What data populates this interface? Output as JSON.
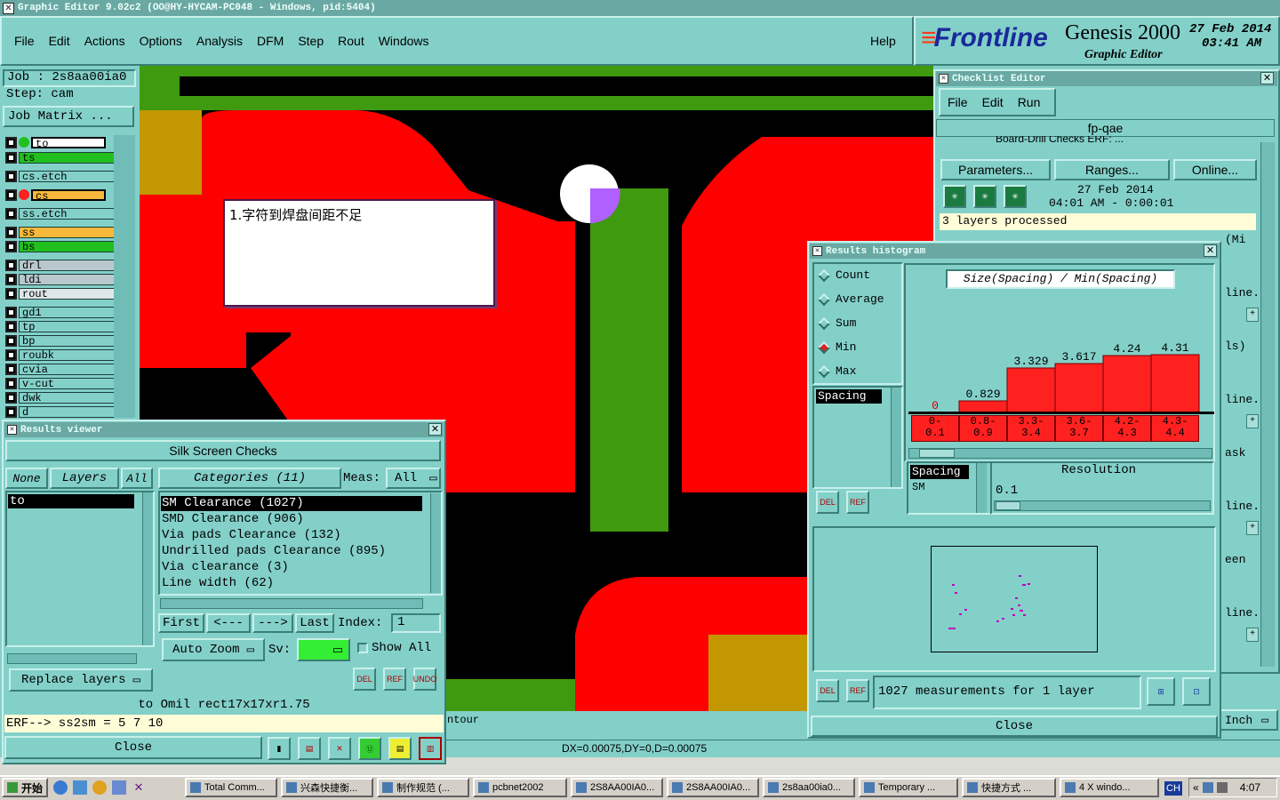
{
  "app": {
    "title": "Graphic Editor 9.02c2 (OO@HY-HYCAM-PC048 - Windows, pid:5404)",
    "menu": [
      "File",
      "Edit",
      "Actions",
      "Options",
      "Analysis",
      "DFM",
      "Step",
      "Rout",
      "Windows"
    ],
    "help": "Help",
    "brand": "Frontline",
    "product": "Genesis 2000",
    "subtitle": "Graphic Editor",
    "date": "27 Feb 2014",
    "time": "03:41 AM"
  },
  "job": {
    "job_label": "Job : 2s8aa00ia0",
    "step_label": "Step: cam",
    "matrix_button": "Job Matrix ..."
  },
  "layers": [
    {
      "name": "to",
      "color": "#ffffff",
      "sel": true
    },
    {
      "name": "ts",
      "color": "#22c01e"
    },
    {
      "name": "cs.etch",
      "color": "#83d0c9"
    },
    {
      "name": "cs",
      "color": "#f7b83b",
      "sel": true
    },
    {
      "name": "ss.etch",
      "color": "#83d0c9"
    },
    {
      "name": "ss",
      "color": "#f7b83b"
    },
    {
      "name": "bs",
      "color": "#22c01e"
    },
    {
      "name": "drl",
      "color": "#b9c8cc"
    },
    {
      "name": "ldi",
      "color": "#b9c8cc"
    },
    {
      "name": "rout",
      "color": "#dfe6e8"
    },
    {
      "name": "gd1",
      "color": "#83d0c9"
    },
    {
      "name": "tp",
      "color": "#83d0c9"
    },
    {
      "name": "bp",
      "color": "#83d0c9"
    },
    {
      "name": "roubk",
      "color": "#83d0c9"
    },
    {
      "name": "cvia",
      "color": "#83d0c9"
    },
    {
      "name": "v-cut",
      "color": "#83d0c9"
    },
    {
      "name": "dwk",
      "color": "#83d0c9"
    },
    {
      "name": "d",
      "color": "#83d0c9"
    }
  ],
  "annotation": "1.字符到焊盘间距不足",
  "checklist": {
    "title": "Checklist Editor",
    "menu": [
      "File",
      "Edit",
      "Run"
    ],
    "name": "fp-qae",
    "partial_row": "Board-Drill Checks   ERF:  ...",
    "buttons": [
      "Parameters...",
      "Ranges...",
      "Online..."
    ],
    "run_date": "27 Feb 2014",
    "run_time": "04:01 AM - 0:00:01",
    "status": "3 layers processed",
    "side_fragments": [
      "(Mi",
      "line...",
      "ls)",
      "line...",
      "ask",
      "line...",
      "een",
      "line..."
    ]
  },
  "results_viewer": {
    "title": "Results viewer",
    "heading": "Silk Screen Checks",
    "tabs": [
      "None",
      "Layers",
      "All"
    ],
    "layer_items": [
      "to"
    ],
    "categories_label": "Categories (11)",
    "meas_label": "Meas:",
    "meas_value": "All",
    "categories": [
      "SM Clearance (1027)",
      "SMD Clearance (906)",
      "Via pads Clearance (132)",
      "Undrilled pads Clearance (895)",
      "Via clearance (3)",
      "Line width (62)"
    ],
    "nav": [
      "First",
      "<---",
      "--->",
      "Last"
    ],
    "index_label": "Index:",
    "index_value": "1",
    "auto_zoom": "Auto Zoom",
    "sv_label": "Sv:",
    "show_all": "Show All",
    "replace": "Replace layers",
    "icon_labels": [
      "DEL",
      "REF",
      "UNDO"
    ],
    "status1": "to  Omil   rect17x17xr1.75",
    "status2": "ERF--> ss2sm = 5 7 10",
    "close": "Close"
  },
  "histogram": {
    "title": "Results histogram",
    "modes": [
      "Count",
      "Average",
      "Sum",
      "Min",
      "Max"
    ],
    "selected_mode": "Min",
    "x_list": [
      "Spacing"
    ],
    "chart_title": "Size(Spacing) / Min(Spacing)",
    "resolution_label": "Resolution",
    "resolution_value": "0.1",
    "y_list": [
      "Spacing",
      "SM"
    ],
    "summary": "1027 measurements for 1 layer",
    "close": "Close",
    "icon_labels": [
      "DEL",
      "REF"
    ]
  },
  "chart_data": {
    "type": "bar",
    "title": "Size(Spacing) / Min(Spacing)",
    "categories": [
      "0-0.1",
      "0.8-0.9",
      "3.3-3.4",
      "3.6-3.7",
      "4.2-4.3",
      "4.3-4.4"
    ],
    "category_labels": [
      [
        "0-",
        "0.1"
      ],
      [
        "0.8-",
        "0.9"
      ],
      [
        "3.3-",
        "3.4"
      ],
      [
        "3.6-",
        "3.7"
      ],
      [
        "4.2-",
        "4.3"
      ],
      [
        "4.3-",
        "4.4"
      ]
    ],
    "values": [
      0,
      0.829,
      3.329,
      3.617,
      4.24,
      4.31
    ],
    "value_labels": [
      "0",
      "0.829",
      "3.329",
      "3.617",
      "4.24",
      "4.31"
    ],
    "ylim": [
      0,
      5.5
    ],
    "bar_color": "#ff2020"
  },
  "bottom": {
    "contour_text": "ntour",
    "coords": "DX=0.00075,DY=0,D=0.00075",
    "units": "Inch"
  },
  "taskbar": {
    "start": "开始",
    "items": [
      "Total Comm...",
      "兴森快捷衡...",
      "制作规范 (...",
      "pcbnet2002",
      "2S8AA00IA0...",
      "2S8AA00IA0...",
      "2s8aa00ia0...",
      "Temporary ...",
      "快捷方式 ...",
      "4 X windo..."
    ],
    "lang": "CH",
    "clock": "4:07"
  }
}
